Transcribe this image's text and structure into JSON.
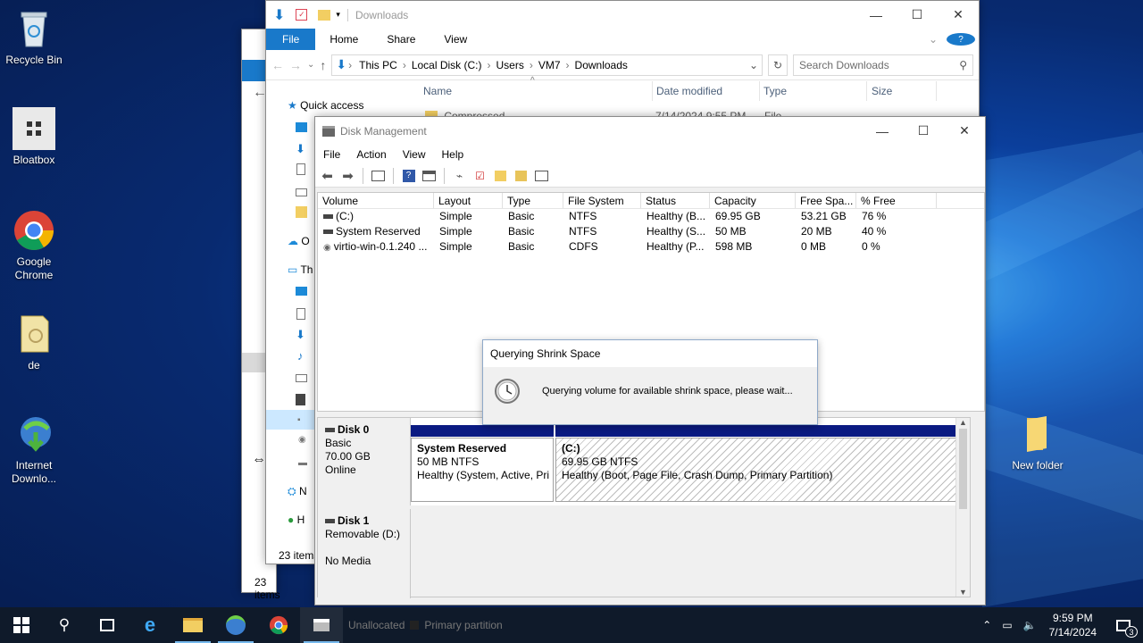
{
  "desktop": {
    "icons": [
      {
        "label": "Recycle Bin"
      },
      {
        "label": "Bloatbox"
      },
      {
        "label": "Google Chrome"
      },
      {
        "label": "de"
      },
      {
        "label": "Internet Downlo..."
      },
      {
        "label": "New folder"
      }
    ]
  },
  "explorer": {
    "title": "Downloads",
    "tabs": [
      "File",
      "Home",
      "Share",
      "View"
    ],
    "breadcrumb": [
      "This PC",
      "Local Disk (C:)",
      "Users",
      "VM7",
      "Downloads"
    ],
    "search_placeholder": "Search Downloads",
    "columns": [
      "Name",
      "Date modified",
      "Type",
      "Size"
    ],
    "row_partial": {
      "name": "Compressed",
      "date": "7/14/2024 9:55 PM",
      "type": "File folder"
    },
    "nav": {
      "quick_access": "Quick access",
      "onedrive": "O",
      "this_pc": "Th",
      "network": "N",
      "homegroup": "H"
    },
    "status": "23 items",
    "back_status": "23 items"
  },
  "diskmgmt": {
    "title": "Disk Management",
    "menu": [
      "File",
      "Action",
      "View",
      "Help"
    ],
    "columns": [
      "Volume",
      "Layout",
      "Type",
      "File System",
      "Status",
      "Capacity",
      "Free Spa...",
      "% Free"
    ],
    "volumes": [
      {
        "volume": "(C:)",
        "layout": "Simple",
        "type": "Basic",
        "fs": "NTFS",
        "status": "Healthy (B...",
        "capacity": "69.95 GB",
        "free": "53.21 GB",
        "pct": "76 %"
      },
      {
        "volume": "System Reserved",
        "layout": "Simple",
        "type": "Basic",
        "fs": "NTFS",
        "status": "Healthy (S...",
        "capacity": "50 MB",
        "free": "20 MB",
        "pct": "40 %"
      },
      {
        "volume": "virtio-win-0.1.240 ...",
        "layout": "Simple",
        "type": "Basic",
        "fs": "CDFS",
        "status": "Healthy (P...",
        "capacity": "598 MB",
        "free": "0 MB",
        "pct": "0 %"
      }
    ],
    "disks": [
      {
        "name": "Disk 0",
        "kind": "Basic",
        "size": "70.00 GB",
        "state": "Online",
        "partitions": [
          {
            "name": "System Reserved",
            "size": "50 MB NTFS",
            "status": "Healthy (System, Active, Pri"
          },
          {
            "name": "(C:)",
            "size": "69.95 GB NTFS",
            "status": "Healthy (Boot, Page File, Crash Dump, Primary Partition)"
          }
        ]
      },
      {
        "name": "Disk 1",
        "kind": "Removable (D:)",
        "state": "No Media"
      }
    ],
    "legend": {
      "unallocated": "Unallocated",
      "primary": "Primary partition"
    }
  },
  "dialog": {
    "title": "Querying Shrink Space",
    "message": "Querying volume for available shrink space, please wait..."
  },
  "taskbar": {
    "time": "9:59 PM",
    "date": "7/14/2024",
    "notifications": "3"
  }
}
